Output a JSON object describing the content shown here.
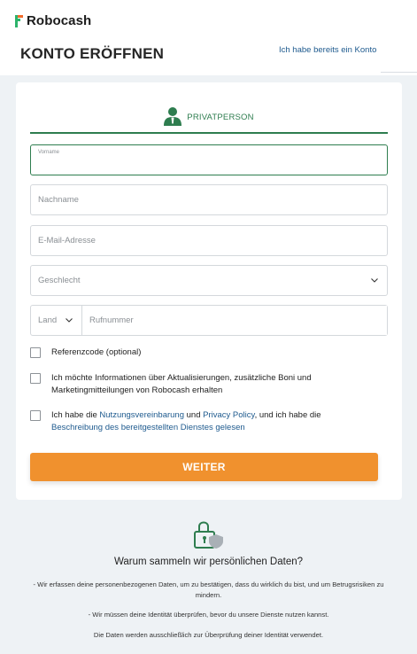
{
  "header": {
    "brand": "Robocash",
    "title": "KONTO ERÖFFNEN",
    "login_link": "Ich habe bereits ein Konto"
  },
  "tab": {
    "label": "PRIVATPERSON",
    "icon": "person-icon"
  },
  "form": {
    "first_name": {
      "label": "Vorname",
      "value": ""
    },
    "last_name": {
      "placeholder": "Nachname"
    },
    "email": {
      "placeholder": "E-Mail-Adresse"
    },
    "gender": {
      "placeholder": "Geschlecht"
    },
    "country": {
      "placeholder": "Land"
    },
    "phone": {
      "placeholder": "Rufnummer"
    },
    "referral_label": "Referenzcode (optional)",
    "marketing_label": "Ich möchte Informationen über Aktualisierungen, zusätzliche Boni und Marketingmitteilungen von Robocash erhalten",
    "terms": {
      "prefix": "Ich habe die ",
      "terms_link": "Nutzungsvereinbarung",
      "and": " und ",
      "privacy_link": "Privacy Policy",
      "middle": ", und ich habe die",
      "service_link": "Beschreibung des bereitgestellten Dienstes gelesen"
    },
    "submit_label": "WEITER"
  },
  "info": {
    "title": "Warum sammeln wir persönlichen Daten?",
    "line1": "- Wir erfassen deine personenbezogenen Daten, um zu bestätigen, dass du wirklich du bist, und um Betrugsrisiken zu mindern.",
    "line2": "- Wir müssen deine Identität überprüfen, bevor du unsere Dienste nutzen kannst.",
    "line3": "Die Daten werden ausschließlich zur Überprüfung deiner Identität verwendet."
  },
  "colors": {
    "brand_green": "#2e7d4f",
    "accent_orange": "#f0912e",
    "link_blue": "#1e5a8e",
    "logo_orange": "#f26b2a",
    "logo_green": "#2db36b"
  }
}
